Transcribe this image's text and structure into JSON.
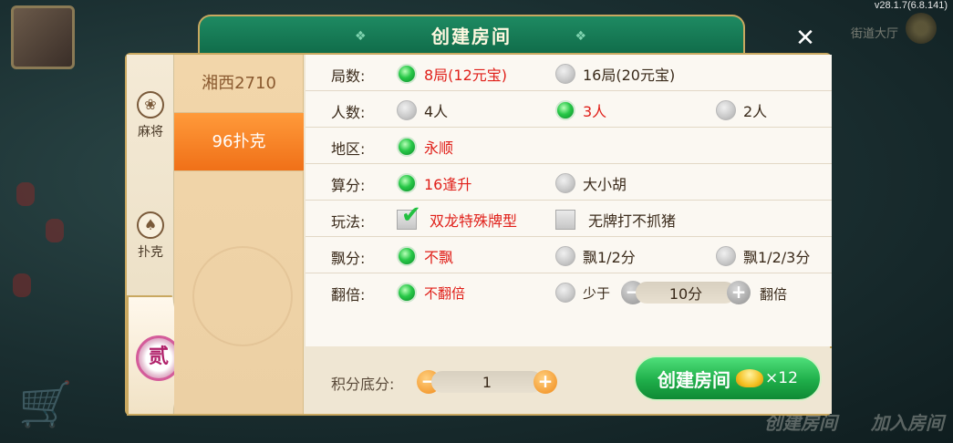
{
  "version": "v28.1.7(6.8.141)",
  "background": {
    "hall_text": "街道大厅",
    "bottom_create": "创建房间",
    "bottom_join": "加入房间"
  },
  "dialog": {
    "title": "创建房间",
    "close_icon": "✕"
  },
  "categories": [
    {
      "label": "麻将",
      "icon": "mahjong-icon",
      "glyph": "❀"
    },
    {
      "label": "扑克",
      "icon": "spade-icon",
      "glyph": "♠"
    },
    {
      "label": "贰",
      "icon": "seal-icon"
    }
  ],
  "games": [
    {
      "label": "湘西2710",
      "active": false
    },
    {
      "label": "96扑克",
      "active": true
    }
  ],
  "rows": {
    "rounds": {
      "label": "局数:",
      "opt1": "8局(12元宝)",
      "opt2": "16局(20元宝)"
    },
    "players": {
      "label": "人数:",
      "opt1": "4人",
      "opt2": "3人",
      "opt3": "2人"
    },
    "region": {
      "label": "地区:",
      "opt1": "永顺"
    },
    "scoring": {
      "label": "算分:",
      "opt1": "16逢升",
      "opt2": "大小胡"
    },
    "play": {
      "label": "玩法:",
      "opt1": "双龙特殊牌型",
      "opt2": "无牌打不抓猪"
    },
    "float": {
      "label": "飘分:",
      "opt1": "不飘",
      "opt2": "飘1/2分",
      "opt3": "飘1/2/3分"
    },
    "double": {
      "label": "翻倍:",
      "opt1": "不翻倍",
      "opt2": "少于",
      "value": "10分",
      "suffix": "翻倍"
    }
  },
  "footer": {
    "base_label": "积分底分:",
    "base_value": "1",
    "create_label": "创建房间",
    "create_count": "×12"
  },
  "stepper_glyphs": {
    "minus": "−",
    "plus": "+"
  }
}
